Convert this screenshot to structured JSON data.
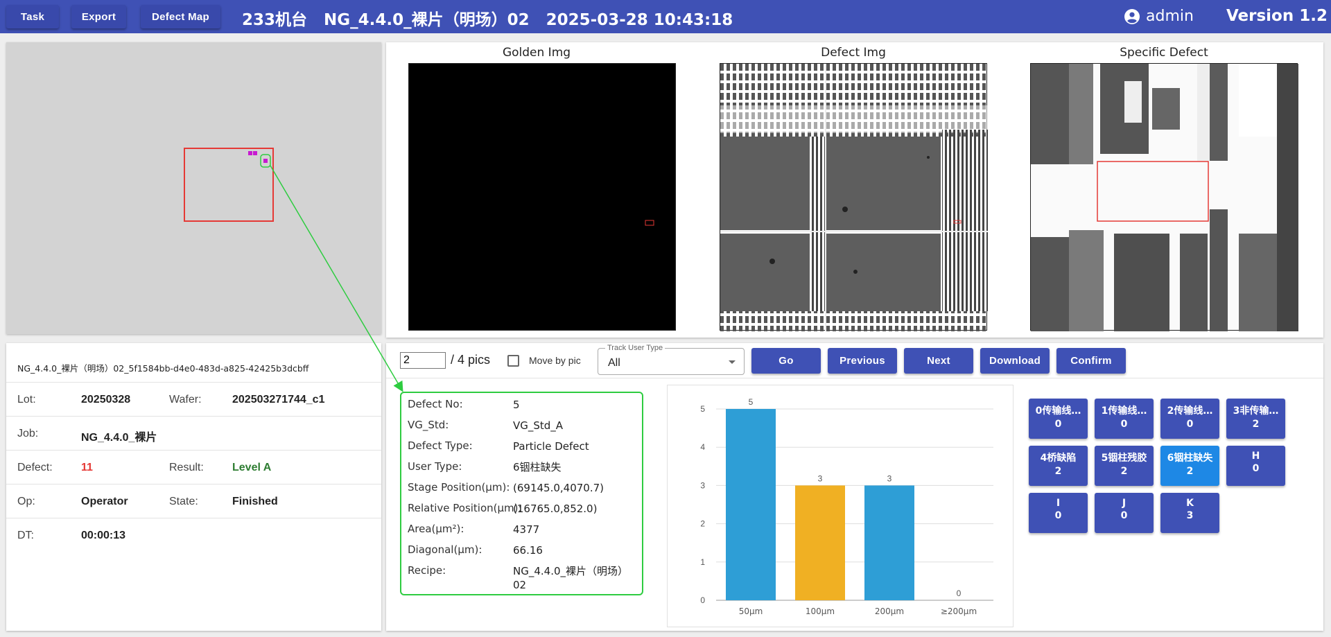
{
  "header": {
    "buttons": [
      "Task",
      "Export",
      "Defect Map"
    ],
    "title": "233机台   NG_4.4.0_裸片（明场）02   2025-03-28 10:43:18",
    "user": "admin",
    "version": "Version 1.2"
  },
  "images": {
    "golden_title": "Golden Img",
    "defect_title": "Defect Img",
    "specific_title": "Specific Defect"
  },
  "info": {
    "name": "NG_4.4.0_裸片（明场）02_5f1584bb-d4e0-483d-a825-42425b3dcbff",
    "lot_label": "Lot:",
    "lot": "20250328",
    "wafer_label": "Wafer:",
    "wafer": "202503271744_c1",
    "job_label": "Job:",
    "job": "NG_4.4.0_裸片",
    "defect_label": "Defect:",
    "defect": "11",
    "result_label": "Result:",
    "result": "Level A",
    "op_label": "Op:",
    "op": "Operator",
    "state_label": "State:",
    "state": "Finished",
    "dt_label": "DT:",
    "dt": "00:00:13"
  },
  "controls": {
    "page": "2",
    "pics": "/ 4 pics",
    "move_label": "Move by pic",
    "track_label": "Track User Type",
    "track_value": "All",
    "go": "Go",
    "previous": "Previous",
    "next": "Next",
    "download": "Download",
    "confirm": "Confirm"
  },
  "defect": {
    "labels": [
      "Defect No:",
      "VG_Std:",
      "Defect Type:",
      "User Type:",
      "Stage Position(μm):",
      "Relative Position(μm):",
      "Area(μm²):",
      "Diagonal(μm):",
      "Recipe:"
    ],
    "values": [
      "5",
      "VG_Std_A",
      "Particle Defect",
      "6铟柱缺失",
      "(69145.0,4070.7)",
      "(16765.0,852.0)",
      "4377",
      "66.16",
      "NG_4.4.0_裸片（明场）02"
    ]
  },
  "chart_data": {
    "type": "bar",
    "categories": [
      "50μm",
      "100μm",
      "200μm",
      "≥200μm"
    ],
    "values": [
      5,
      3,
      3,
      0
    ],
    "bar_colors": [
      "#2e9ed6",
      "#f0b023",
      "#2e9ed6",
      "#2e9ed6"
    ],
    "yticks": [
      "0",
      "1",
      "2",
      "3",
      "4",
      "5"
    ],
    "ylim": [
      0,
      5
    ],
    "grid": true
  },
  "types": [
    {
      "label": "0传输线…",
      "count": "0"
    },
    {
      "label": "1传输线…",
      "count": "0"
    },
    {
      "label": "2传输线…",
      "count": "0"
    },
    {
      "label": "3非传输…",
      "count": "2"
    },
    {
      "label": "4桥缺陷",
      "count": "2"
    },
    {
      "label": "5铟柱残胶",
      "count": "2"
    },
    {
      "label": "6铟柱缺失",
      "count": "2"
    },
    {
      "label": "H",
      "count": "0"
    },
    {
      "label": "I",
      "count": "0"
    },
    {
      "label": "J",
      "count": "0"
    },
    {
      "label": "K",
      "count": "3"
    }
  ],
  "colors": {
    "header": "#3f51b5",
    "button": "#3f51b5",
    "active": "#1e88e5",
    "defect_box": "#2ecc40",
    "mark": "#e53935"
  }
}
